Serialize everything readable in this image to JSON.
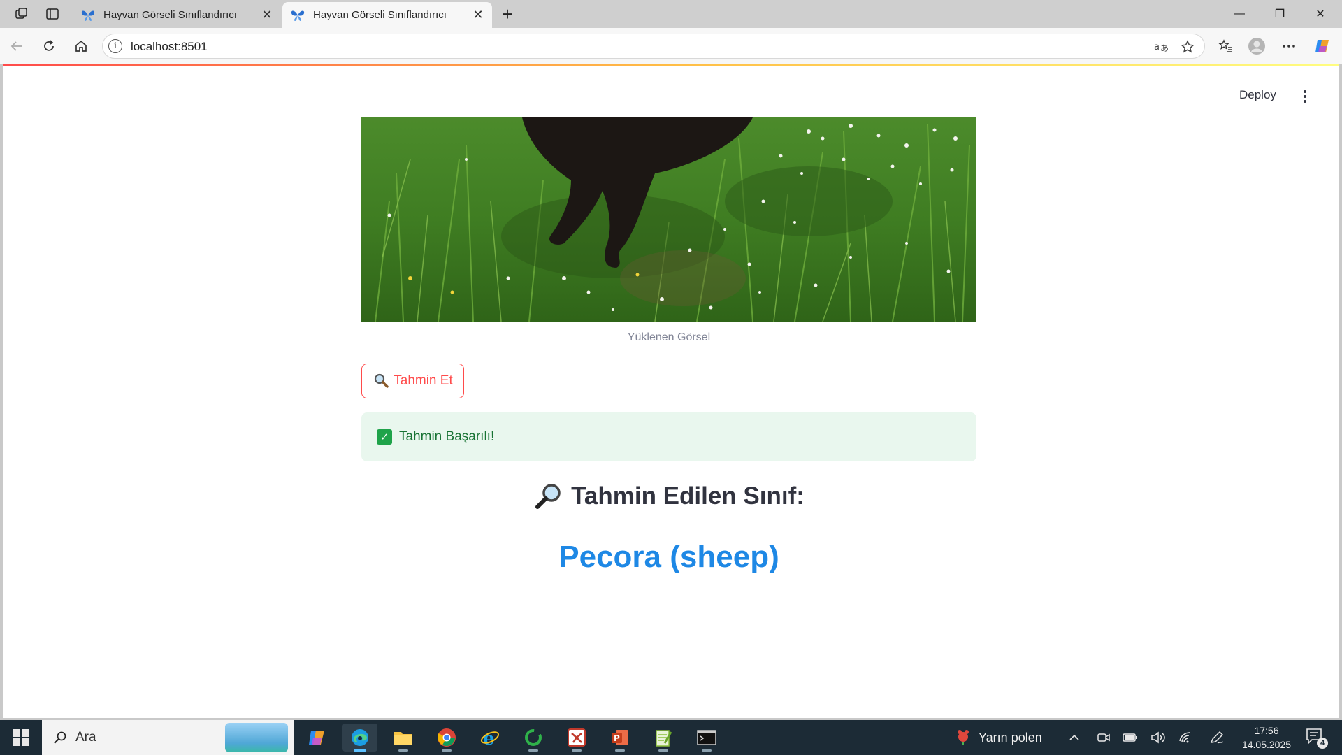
{
  "browser": {
    "tabs": [
      {
        "title": "Hayvan Görseli Sınıflandırıcı",
        "active": false
      },
      {
        "title": "Hayvan Görseli Sınıflandırıcı",
        "active": true
      }
    ],
    "url": "localhost:8501",
    "close_glyph": "✕",
    "new_tab_glyph": "+",
    "window_controls": {
      "minimize": "—",
      "restore": "❐",
      "close": "✕"
    }
  },
  "app": {
    "deploy_label": "Deploy",
    "image_caption": "Yüklenen Görsel",
    "predict_button_label": "Tahmin Et",
    "success_message": "Tahmin Başarılı!",
    "prediction_heading": "Tahmin Edilen Sınıf:",
    "prediction_result": "Pecora (sheep)",
    "accent_color": "#ff4b4b",
    "result_color": "#1e88e5",
    "success_bg": "#e9f7ee"
  },
  "taskbar": {
    "search_label": "Ara",
    "apps": [
      "copilot-app",
      "edge-browser",
      "file-explorer",
      "chrome",
      "internet-explorer",
      "green-ring-app",
      "red-app",
      "powerpoint",
      "notepad-plus-plus",
      "terminal"
    ],
    "weather_text": "Yarın polen",
    "time": "17:56",
    "date": "14.05.2025",
    "notification_count": "4"
  }
}
